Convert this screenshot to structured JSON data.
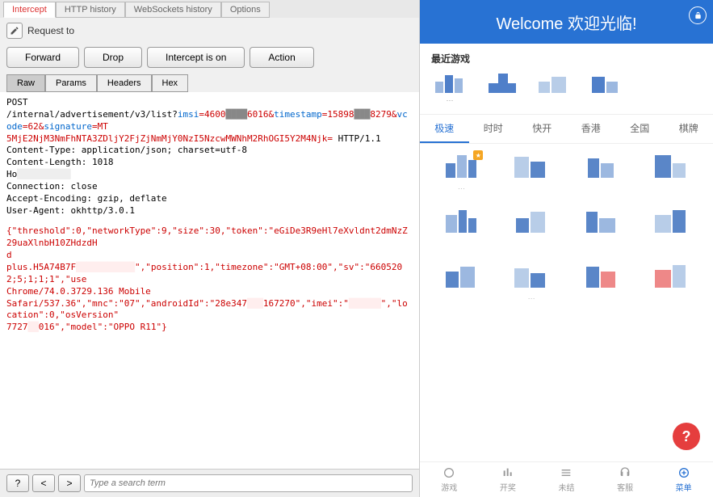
{
  "burp": {
    "top_tabs": [
      "Intercept",
      "HTTP history",
      "WebSockets history",
      "Options"
    ],
    "request_label": "Request to",
    "buttons": {
      "forward": "Forward",
      "drop": "Drop",
      "intercept": "Intercept is on",
      "action": "Action"
    },
    "sub_tabs": [
      "Raw",
      "Params",
      "Headers",
      "Hex"
    ],
    "raw": {
      "l1": "POST",
      "l2a": "/internal/advertisement/v3/list?",
      "l2b": "imsi",
      "l2c": "=4600",
      "l2d": "6016&",
      "l2e": "timestamp",
      "l2f": "=15898",
      "l2g": "8279&",
      "l2h": "vcode",
      "l2i": "=62&",
      "l2j": "signature",
      "l2k": "=MT",
      "l3": "5MjE2NjM3NmFhNTA3ZDljY2FjZjNmMjY0NzI5NzcwMWNhM2RhOGI5Y2M4Njk=",
      "l3b": " HTTP/1.1",
      "l4": "Content-Type: application/json; charset=utf-8",
      "l5": "Content-Length: 1018",
      "l6": "Ho",
      "l7": "Connection: close",
      "l8": "Accept-Encoding: gzip, deflate",
      "l9": "User-Agent: okhttp/3.0.1",
      "b1a": "{\"threshold\":0,\"networkType\":9,\"size\":30,\"token\":\"",
      "b1b": "eGiDe3R9eHl7eXvldnt2dmNzZ29uaXlnbH10ZHdzdH",
      "b2a": "d",
      "b3a": "plus.H5A74B7F",
      "b3b": "\",\"position\":1,\"timezone\":\"GMT+08:00\",\"sv\":\"6605202;5;1;1;1\",\"use",
      "b4": "Chrome/74.0.3729.136 Mobile",
      "b5a": "Safari/537.36\",\"mnc\":\"07\",\"androidId\":\"",
      "b5b": "28e347",
      "b5c": "167270\",\"imei\":\"",
      "b5d": "\",\"location\":0,\"osVersion\"",
      "b6a": "7727",
      "b6b": "016\",\"model\":\"OPPO R11\"}"
    },
    "nav": {
      "q": "?",
      "lt": "<",
      "gt": ">",
      "search_ph": "Type a search term"
    }
  },
  "app": {
    "title": "Welcome 欢迎光临!",
    "recent_label": "最近游戏",
    "cat_tabs": [
      "极速",
      "时时",
      "快开",
      "香港",
      "全国",
      "棋牌"
    ],
    "fab": "?",
    "bottom": [
      "游戏",
      "开奖",
      "未结",
      "客服",
      "菜单"
    ]
  }
}
